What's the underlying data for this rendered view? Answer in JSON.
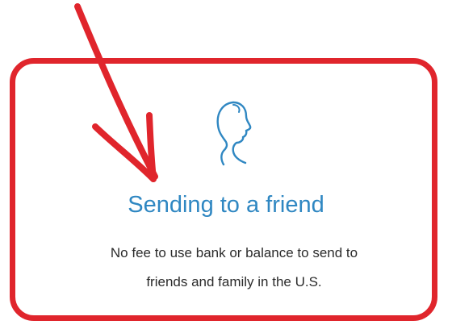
{
  "card": {
    "title": "Sending to a friend",
    "description_line_1": "No fee to use bank or balance to send to",
    "description_line_2": "friends and family in the U.S.",
    "icon": "person-profile-outline-icon"
  },
  "annotations": {
    "arrow": "red-hand-drawn-arrow",
    "highlight": "red-rounded-rectangle",
    "color": "#e0252c"
  },
  "colors": {
    "title": "#2f87c2",
    "text": "#2b2b2b",
    "background": "#ffffff"
  }
}
